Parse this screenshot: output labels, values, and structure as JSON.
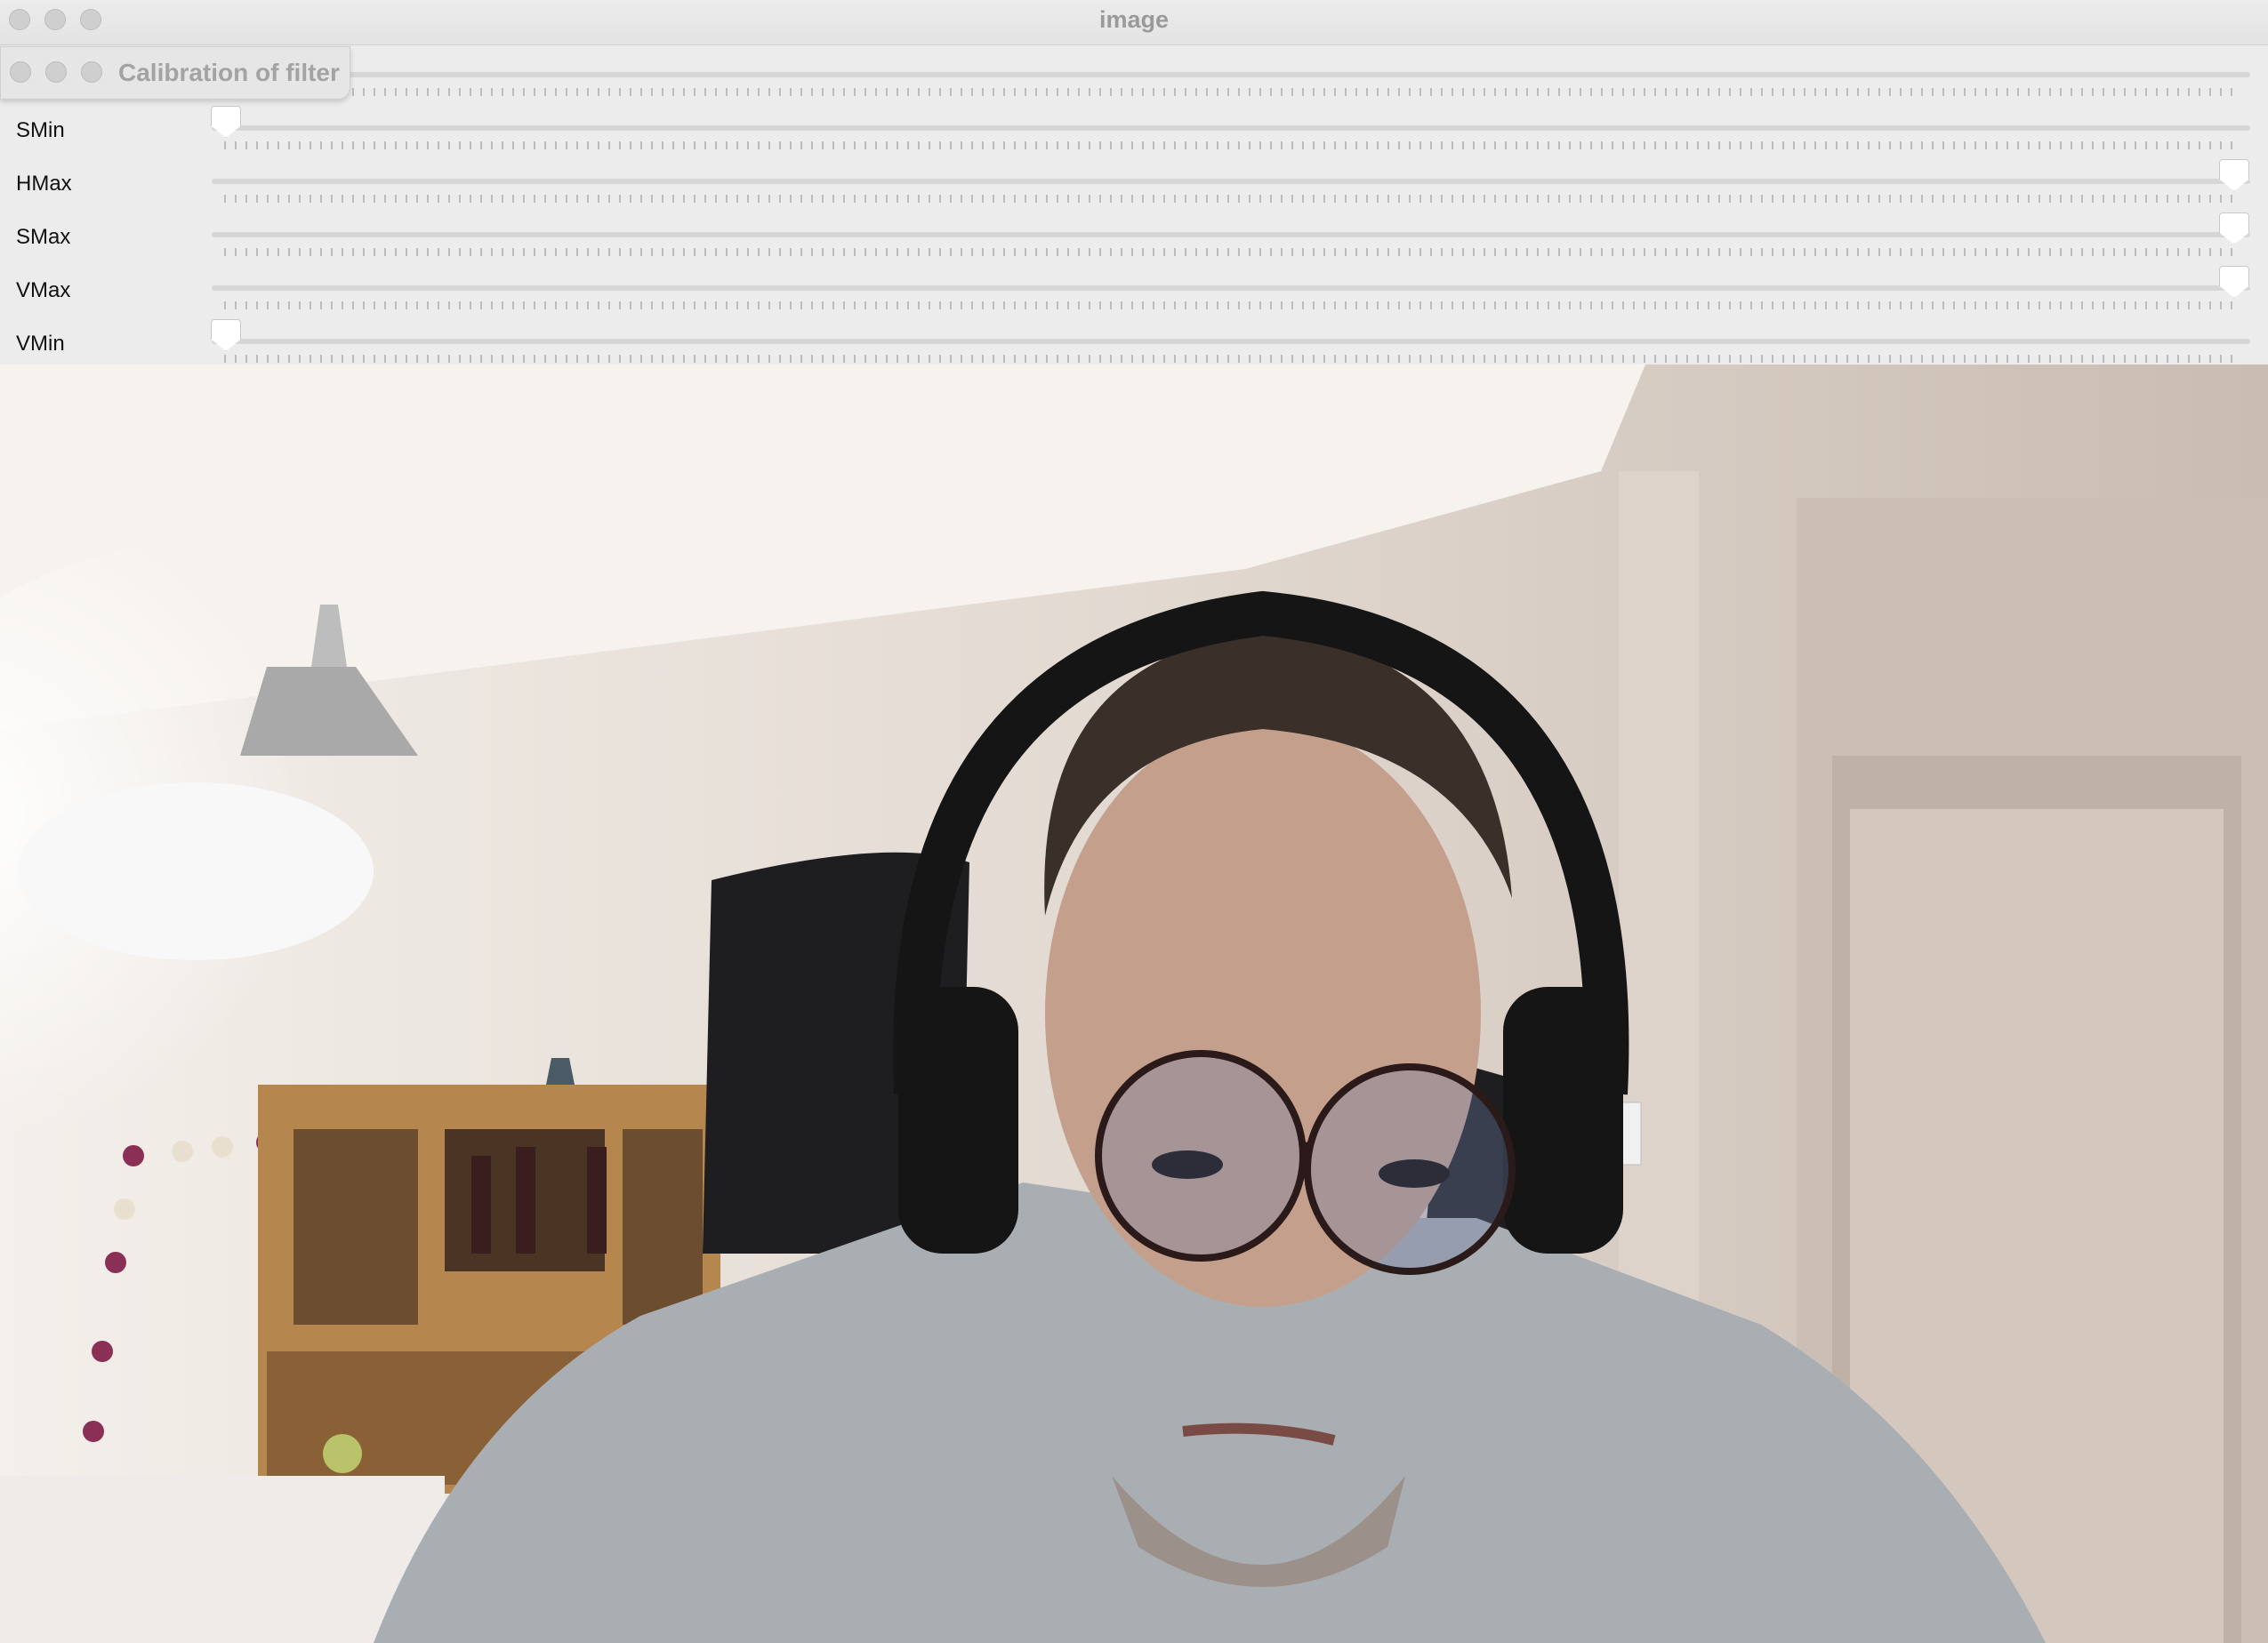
{
  "window": {
    "title": "image"
  },
  "panel": {
    "title": "Calibration of filter"
  },
  "sliders": [
    {
      "label": "",
      "value_fraction": 0.0
    },
    {
      "label": "SMin",
      "value_fraction": 0.0
    },
    {
      "label": "HMax",
      "value_fraction": 1.0
    },
    {
      "label": "SMax",
      "value_fraction": 1.0
    },
    {
      "label": "VMax",
      "value_fraction": 1.0
    },
    {
      "label": "VMin",
      "value_fraction": 0.0
    }
  ],
  "colors": {
    "window_bg": "#ececec",
    "traffic_light": "#cfcfcf",
    "track": "#d6d6d6",
    "thumb": "#ffffff"
  },
  "camera": {
    "description_icon": "webcam-feed"
  }
}
